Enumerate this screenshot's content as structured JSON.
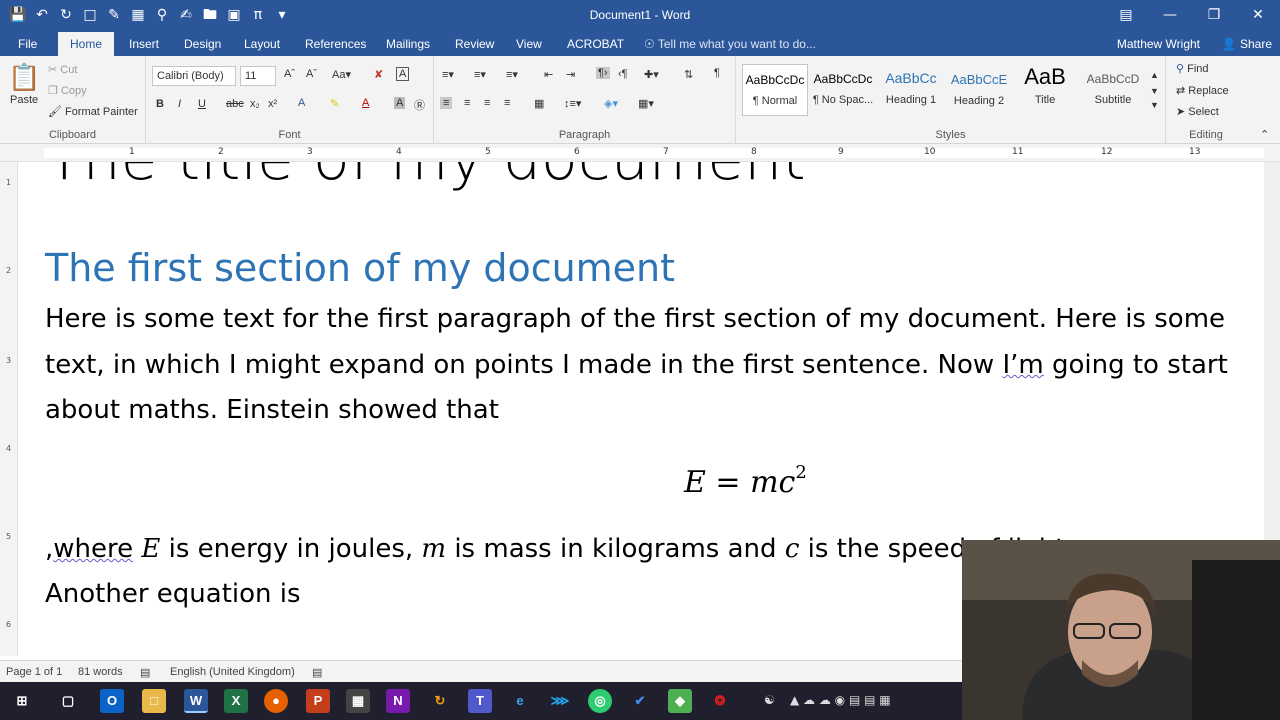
{
  "window": {
    "title": "Document1 - Word",
    "qat_icons": [
      "save-icon",
      "undo-icon",
      "redo-icon",
      "new-doc-icon",
      "paint-icon",
      "table-icon",
      "find-icon",
      "edit-icon",
      "folder-icon",
      "picture-icon",
      "pi-icon",
      "dropdown-icon"
    ]
  },
  "tabs": {
    "file": "File",
    "home": "Home",
    "insert": "Insert",
    "design": "Design",
    "layout": "Layout",
    "references": "References",
    "mailings": "Mailings",
    "review": "Review",
    "view": "View",
    "acrobat": "ACROBAT",
    "tell_me": "Tell me what you want to do...",
    "user": "Matthew Wright",
    "share": "Share"
  },
  "ribbon": {
    "clipboard": {
      "label": "Clipboard",
      "paste": "Paste",
      "cut": "Cut",
      "copy": "Copy",
      "format_painter": "Format Painter"
    },
    "font": {
      "label": "Font",
      "family": "Calibri (Body)",
      "size": "11"
    },
    "paragraph": {
      "label": "Paragraph"
    },
    "styles": {
      "label": "Styles",
      "items": [
        {
          "sample": "AaBbCcDc",
          "name": "¶ Normal"
        },
        {
          "sample": "AaBbCcDc",
          "name": "¶ No Spac..."
        },
        {
          "sample": "AaBbCc",
          "name": "Heading 1"
        },
        {
          "sample": "AaBbCcE",
          "name": "Heading 2"
        },
        {
          "sample": "AaB",
          "name": "Title"
        },
        {
          "sample": "AaBbCcD",
          "name": "Subtitle"
        }
      ]
    },
    "editing": {
      "label": "Editing",
      "find": "Find",
      "replace": "Replace",
      "select": "Select"
    }
  },
  "document": {
    "title": "The title of my document",
    "heading": "The first section of my document",
    "para_line1": "Here is some text for the first paragraph of the first section of my document. Here is some",
    "para_line2_a": "text, in which I might expand on points I made in the first sentence. Now ",
    "para_line2_im": "I’m",
    "para_line2_b": " going to start",
    "para_line3": "about maths. Einstein showed that",
    "equation_base": "E = mc",
    "equation_exp": "2",
    "where_line": {
      "comma": ",",
      "where": "where",
      "var_e": "E",
      "t1": " is energy in joules, ",
      "var_m": "m",
      "t2": " is mass in kilograms and ",
      "var_c": "c",
      "t3": " is the speed of light"
    },
    "para_last": "Another equation is"
  },
  "status": {
    "page": "Page 1 of 1",
    "words": "81 words",
    "language": "English (United Kingdom)"
  },
  "ruler_numbers": [
    "1",
    "2",
    "3",
    "4",
    "5",
    "6",
    "7",
    "8",
    "9",
    "10",
    "11",
    "12",
    "13"
  ],
  "vruler_numbers": [
    "1",
    "2",
    "3",
    "4",
    "5",
    "6"
  ],
  "taskbar": {
    "apps": [
      "windows-start",
      "task-view",
      "outlook",
      "file-explorer",
      "word",
      "excel",
      "firefox",
      "powerpoint",
      "calculator",
      "onenote",
      "sync",
      "teams",
      "edge",
      "vscode",
      "browser-green",
      "todo",
      "app-green",
      "acrobat"
    ]
  },
  "colors": {
    "word_blue": "#2b579a",
    "heading_blue": "#2e74b5"
  }
}
